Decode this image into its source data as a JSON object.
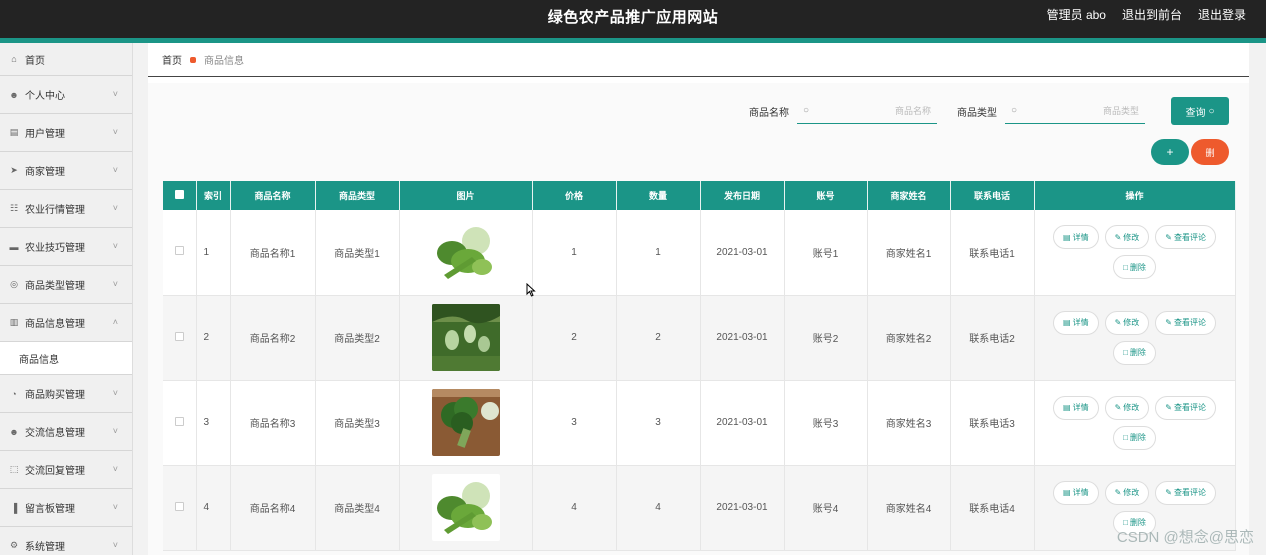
{
  "header": {
    "title": "绿色农产品推广应用网站",
    "admin": "管理员 abo",
    "to_front": "退出到前台",
    "logout": "退出登录"
  },
  "sidebar": {
    "items": [
      {
        "label": "首页",
        "icon": "home-icon",
        "expand": false
      },
      {
        "label": "个人中心",
        "icon": "user-icon",
        "expand": true
      },
      {
        "label": "用户管理",
        "icon": "chat-icon",
        "expand": true
      },
      {
        "label": "商家管理",
        "icon": "send-icon",
        "expand": true
      },
      {
        "label": "农业行情管理",
        "icon": "grid-icon",
        "expand": true
      },
      {
        "label": "农业技巧管理",
        "icon": "monitor-icon",
        "expand": true
      },
      {
        "label": "商品类型管理",
        "icon": "compass-icon",
        "expand": true
      },
      {
        "label": "商品信息管理",
        "icon": "doc-icon",
        "expand": true,
        "open": true,
        "sub": "商品信息"
      },
      {
        "label": "商品购买管理",
        "icon": "gauge-icon",
        "expand": true
      },
      {
        "label": "交流信息管理",
        "icon": "user-icon",
        "expand": true
      },
      {
        "label": "交流回复管理",
        "icon": "frame-icon",
        "expand": true
      },
      {
        "label": "留言板管理",
        "icon": "bar-icon",
        "expand": true
      },
      {
        "label": "系统管理",
        "icon": "gear-icon",
        "expand": true
      }
    ]
  },
  "breadcrumb": {
    "home": "首页",
    "current": "商品信息"
  },
  "search": {
    "name_label": "商品名称",
    "name_placeholder": "商品名称",
    "type_label": "商品类型",
    "type_placeholder": "商品类型",
    "query_label": "查询"
  },
  "actions": {
    "add": "+",
    "delete": "删"
  },
  "table": {
    "headers": [
      "索引",
      "商品名称",
      "商品类型",
      "图片",
      "价格",
      "数量",
      "发布日期",
      "账号",
      "商家姓名",
      "联系电话",
      "操作"
    ],
    "rows": [
      {
        "idx": "1",
        "name": "商品名称1",
        "type": "商品类型1",
        "image": "cabbage-bunch",
        "price": "1",
        "qty": "1",
        "date": "2021-03-01",
        "account": "账号1",
        "merchant": "商家姓名1",
        "phone": "联系电话1"
      },
      {
        "idx": "2",
        "name": "商品名称2",
        "type": "商品类型2",
        "image": "gourd-field",
        "price": "2",
        "qty": "2",
        "date": "2021-03-01",
        "account": "账号2",
        "merchant": "商家姓名2",
        "phone": "联系电话2"
      },
      {
        "idx": "3",
        "name": "商品名称3",
        "type": "商品类型3",
        "image": "broccoli-board",
        "price": "3",
        "qty": "3",
        "date": "2021-03-01",
        "account": "账号3",
        "merchant": "商家姓名3",
        "phone": "联系电话3"
      },
      {
        "idx": "4",
        "name": "商品名称4",
        "type": "商品类型4",
        "image": "cabbage-bunch",
        "price": "4",
        "qty": "4",
        "date": "2021-03-01",
        "account": "账号4",
        "merchant": "商家姓名4",
        "phone": "联系电话4"
      }
    ],
    "op_labels": {
      "detail": "详情",
      "edit": "修改",
      "review": "查看评论",
      "delete": "删除"
    }
  },
  "watermark": "CSDN @想念@思恋",
  "colors": {
    "brand": "#1b9587",
    "danger": "#ee5a2d",
    "topbar": "#232323"
  }
}
